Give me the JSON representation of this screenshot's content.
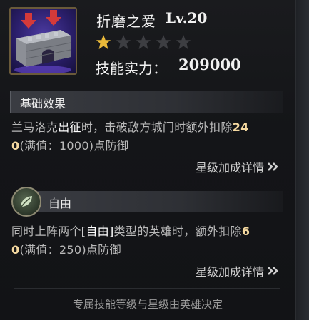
{
  "skill": {
    "name": "折磨之爱",
    "level": "Lv.20",
    "stars_filled": 1,
    "stars_total": 5,
    "power_label": "技能实力：",
    "power_value": "209000",
    "icon": "fortress-gate-icon"
  },
  "basic": {
    "title": "基础效果",
    "desc_pre": "兰马洛克",
    "desc_hl": "出征",
    "desc_post": "时，击破敌方城门时额外扣除",
    "desc_num1": "24",
    "desc_num2": "0",
    "desc_tail": "(满值：1000)点防御",
    "detail_label": "星级加成详情"
  },
  "freedom": {
    "title": "自由",
    "icon": "leaf-badge-icon",
    "desc_pre": "同时上阵两个",
    "desc_hl": "[自由]",
    "desc_post": "类型的英雄时，额外扣除",
    "desc_num1": "6",
    "desc_num2": "0",
    "desc_tail": "(满值：250)点防御",
    "detail_label": "星级加成详情"
  },
  "footer": "专属技能等级与星级由英雄决定",
  "colors": {
    "star_filled": "#e9b93a",
    "star_empty": "#3d3e42",
    "highlight": "#f5d9a0"
  }
}
